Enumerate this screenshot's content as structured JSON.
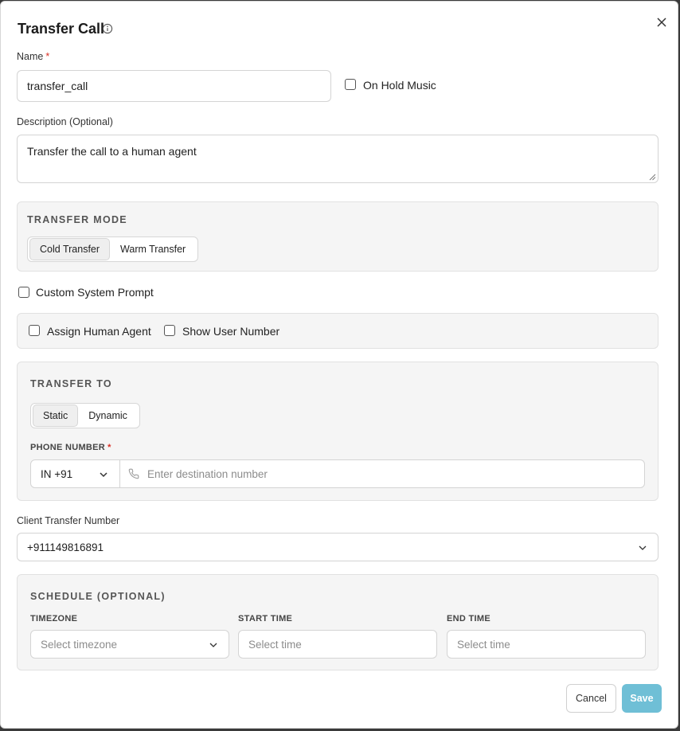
{
  "dialog": {
    "title": "Transfer Call"
  },
  "name": {
    "label": "Name",
    "required_mark": "*",
    "value": "transfer_call"
  },
  "on_hold_music": {
    "label": "On Hold Music",
    "checked": false
  },
  "description": {
    "label": "Description (Optional)",
    "value": "Transfer the call to a human agent"
  },
  "transfer_mode": {
    "title": "TRANSFER MODE",
    "options": [
      "Cold Transfer",
      "Warm Transfer"
    ],
    "selected": "Cold Transfer"
  },
  "custom_system_prompt": {
    "label": "Custom System Prompt",
    "checked": false
  },
  "assign_human_agent": {
    "label": "Assign Human Agent",
    "checked": false
  },
  "show_user_number": {
    "label": "Show User Number",
    "checked": false
  },
  "transfer_to": {
    "title": "TRANSFER TO",
    "options": [
      "Static",
      "Dynamic"
    ],
    "selected": "Static",
    "phone_label": "PHONE NUMBER",
    "required_mark": "*",
    "country_code": "IN +91",
    "phone_placeholder": "Enter destination number"
  },
  "client_transfer": {
    "label": "Client Transfer Number",
    "value": "+911149816891"
  },
  "schedule": {
    "title": "SCHEDULE (OPTIONAL)",
    "timezone_label": "TIMEZONE",
    "timezone_placeholder": "Select timezone",
    "start_label": "START TIME",
    "start_placeholder": "Select time",
    "end_label": "END TIME",
    "end_placeholder": "Select time"
  },
  "footer": {
    "cancel_label": "Cancel",
    "save_label": "Save"
  },
  "colors": {
    "save_button": "#6fbfd6",
    "required": "#d93025",
    "section_bg": "#f5f5f5"
  }
}
